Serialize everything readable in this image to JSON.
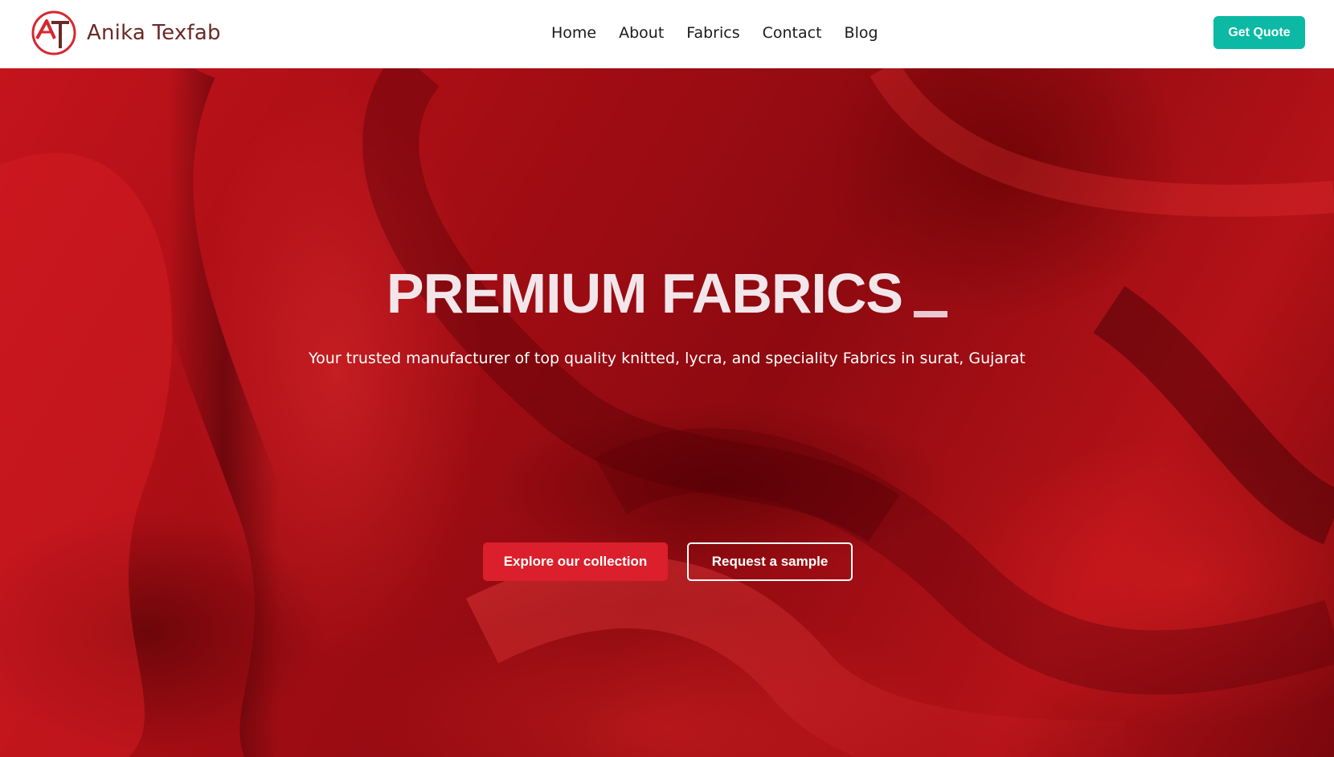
{
  "brand": {
    "logo_text": "AT",
    "name": "Anika Texfab",
    "logo_color": "#d8262f"
  },
  "nav": {
    "items": [
      {
        "label": "Home"
      },
      {
        "label": "About"
      },
      {
        "label": "Fabrics"
      },
      {
        "label": "Contact"
      },
      {
        "label": "Blog"
      }
    ]
  },
  "header": {
    "quote_label": "Get Quote",
    "quote_color": "#0bb9a4"
  },
  "hero": {
    "title": "PREMIUM FABRICS",
    "subtitle": "Your trusted manufacturer of top quality knitted, lycra, and speciality Fabrics in surat, Gujarat",
    "primary_cta": "Explore our collection",
    "secondary_cta": "Request a sample",
    "background_color": "#b3121a",
    "primary_cta_color": "#db1f2c"
  }
}
